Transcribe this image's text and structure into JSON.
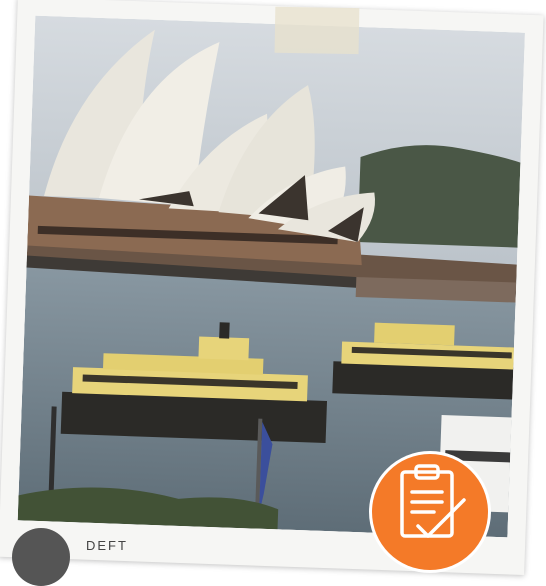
{
  "caption": {
    "text": "DEFT"
  },
  "colors": {
    "frame": "#f6f6f4",
    "badge": "#f47a28",
    "ferry_hull": "#2b2a27",
    "ferry_deck": "#e7d47a",
    "water": "#6f7f8a"
  },
  "icons": {
    "badge": "clipboard-check-icon",
    "avatar": "avatar"
  }
}
